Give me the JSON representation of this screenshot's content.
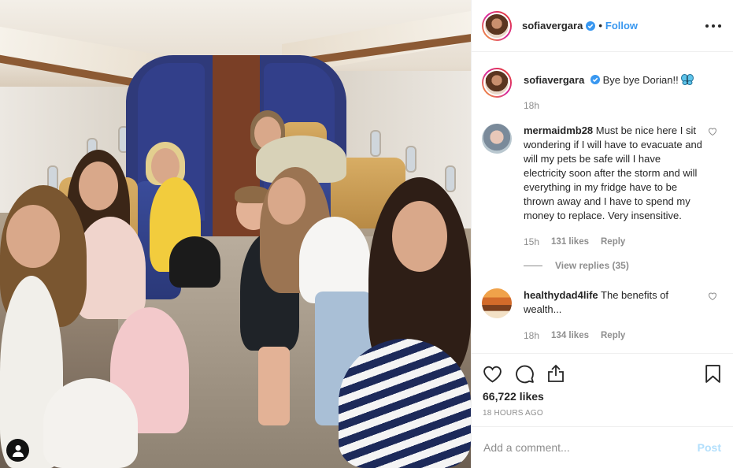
{
  "post": {
    "author": "sofiavergara",
    "verified": true,
    "follow_label": "Follow",
    "separator": "•",
    "caption": {
      "username": "sofiavergara",
      "text": "Bye bye Dorian!!",
      "time": "18h"
    },
    "photo_tag_icon": "user-tag-icon"
  },
  "comments": [
    {
      "username": "mermaidmb28",
      "text": "Must be nice here I sit wondering if I will have to evacuate and will my pets be safe will I have electricity soon after the storm and will everything in my fridge have to be thrown away and I have to spend my money to replace. Very insensitive.",
      "time": "15h",
      "likes": "131 likes",
      "reply_label": "Reply",
      "view_replies": "View replies (35)"
    },
    {
      "username": "healthydad4life",
      "text": "The benefits of wealth...",
      "time": "18h",
      "likes": "134 likes",
      "reply_label": "Reply"
    }
  ],
  "actions": {
    "icons": [
      "heart-icon",
      "comment-icon",
      "share-icon",
      "bookmark-icon"
    ],
    "likes": "66,722 likes",
    "timestamp": "18 HOURS AGO"
  },
  "add_comment": {
    "placeholder": "Add a comment...",
    "post_label": "Post"
  },
  "colors": {
    "link_blue": "#3897f0",
    "muted": "#8e8e8e",
    "post_disabled": "#b2dffc"
  }
}
